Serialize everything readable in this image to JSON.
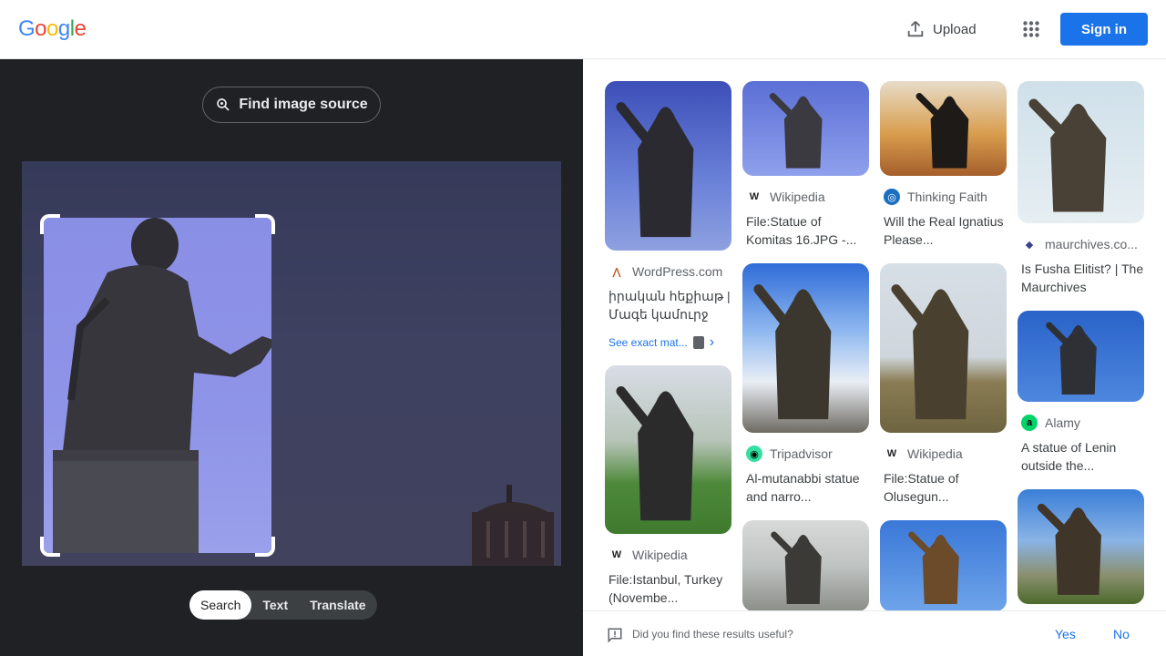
{
  "header": {
    "logo_letters": [
      {
        "ch": "G",
        "color": "#4285F4"
      },
      {
        "ch": "o",
        "color": "#EA4335"
      },
      {
        "ch": "o",
        "color": "#FBBC05"
      },
      {
        "ch": "g",
        "color": "#4285F4"
      },
      {
        "ch": "l",
        "color": "#34A853"
      },
      {
        "ch": "e",
        "color": "#EA4335"
      }
    ],
    "upload_label": "Upload",
    "signin_label": "Sign in"
  },
  "left": {
    "find_source_label": "Find image source",
    "modes": [
      {
        "label": "Search",
        "active": true
      },
      {
        "label": "Text",
        "active": false
      },
      {
        "label": "Translate",
        "active": false
      }
    ]
  },
  "results": {
    "col1": [
      {
        "source": "WordPress.com",
        "favicon": "wordpress-icon",
        "title": "իրական հեքիաթ | Մագե կամուրջ",
        "see_exact": "See exact mat...",
        "thumb_h": 186,
        "scene": "statue-back-blue"
      },
      {
        "source": "Wikipedia",
        "favicon": "wikipedia-icon",
        "title": "File:Istanbul, Turkey (Novembe...",
        "thumb_h": 185,
        "scene": "statue-park"
      }
    ],
    "col2": [
      {
        "source": "Wikipedia",
        "favicon": "wikipedia-icon",
        "title": "File:Statue of Komitas 16.JPG -...",
        "thumb_h": 104,
        "scene": "statue-closeup"
      },
      {
        "source": "Tripadvisor",
        "favicon": "tripadvisor-icon",
        "title": "Al-mutanabbi statue and narro...",
        "thumb_h": 186,
        "scene": "statue-clouds"
      },
      {
        "source": "",
        "favicon": "",
        "title": "",
        "thumb_h": 100,
        "scene": "statue-city"
      }
    ],
    "col3": [
      {
        "source": "Thinking Faith",
        "favicon": "thinkingfaith-icon",
        "title": "Will the Real Ignatius Please...",
        "thumb_h": 104,
        "scene": "statue-sunset"
      },
      {
        "source": "Wikipedia",
        "favicon": "wikipedia-icon",
        "title": "File:Statue of Olusegun...",
        "thumb_h": 186,
        "scene": "statue-field"
      },
      {
        "source": "",
        "favicon": "",
        "title": "",
        "thumb_h": 100,
        "scene": "statue-blue"
      }
    ],
    "col4": [
      {
        "source": "maurchives.co...",
        "favicon": "maurchives-icon",
        "title": "Is Fusha Elitist? | The Maurchives",
        "thumb_h": 156,
        "scene": "statue-pale"
      },
      {
        "source": "Alamy",
        "favicon": "alamy-icon",
        "title": "A statue of Lenin outside the...",
        "thumb_h": 100,
        "scene": "statue-alamy"
      },
      {
        "source": "",
        "favicon": "",
        "title": "",
        "thumb_h": 126,
        "scene": "statue-crowd"
      }
    ]
  },
  "feedback": {
    "question": "Did you find these results useful?",
    "yes": "Yes",
    "no": "No"
  },
  "colors": {
    "accent": "#1a73e8",
    "left_bg": "#202124"
  }
}
